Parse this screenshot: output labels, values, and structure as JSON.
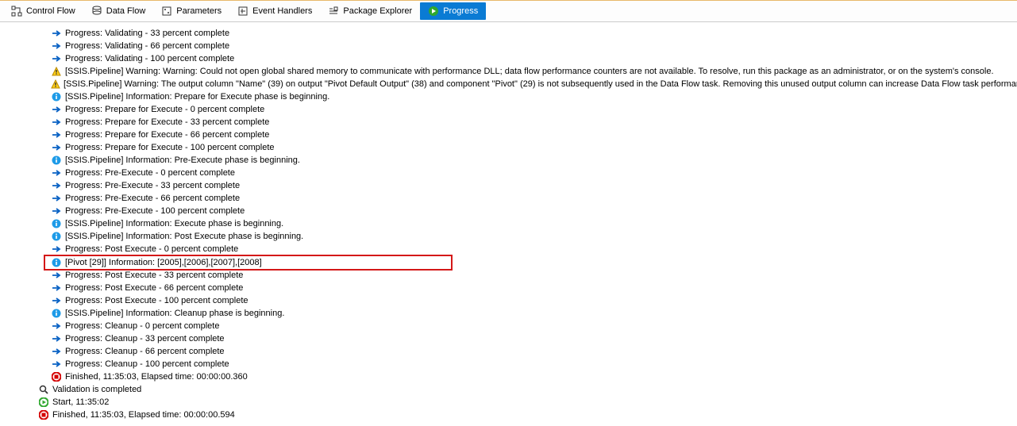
{
  "tabs": {
    "control_flow": "Control Flow",
    "data_flow": "Data Flow",
    "parameters": "Parameters",
    "event_handlers": "Event Handlers",
    "package_explorer": "Package Explorer",
    "progress": "Progress"
  },
  "log": [
    {
      "lvl": 3,
      "icon": "arrow",
      "text": "Progress: Validating - 33 percent complete"
    },
    {
      "lvl": 3,
      "icon": "arrow",
      "text": "Progress: Validating - 66 percent complete"
    },
    {
      "lvl": 3,
      "icon": "arrow",
      "text": "Progress: Validating - 100 percent complete"
    },
    {
      "lvl": 3,
      "icon": "warn",
      "text": "[SSIS.Pipeline] Warning: Warning: Could not open global shared memory to communicate with performance DLL; data flow performance counters are not available.  To resolve, run this package as an administrator, or on the system's console."
    },
    {
      "lvl": 3,
      "icon": "warn",
      "text": "[SSIS.Pipeline] Warning: The output column \"Name\" (39) on output \"Pivot Default Output\" (38) and component \"Pivot\" (29) is not subsequently used in the Data Flow task. Removing this unused output column can increase Data Flow task performance."
    },
    {
      "lvl": 3,
      "icon": "info",
      "text": "[SSIS.Pipeline] Information: Prepare for Execute phase is beginning."
    },
    {
      "lvl": 3,
      "icon": "arrow",
      "text": "Progress: Prepare for Execute - 0 percent complete"
    },
    {
      "lvl": 3,
      "icon": "arrow",
      "text": "Progress: Prepare for Execute - 33 percent complete"
    },
    {
      "lvl": 3,
      "icon": "arrow",
      "text": "Progress: Prepare for Execute - 66 percent complete"
    },
    {
      "lvl": 3,
      "icon": "arrow",
      "text": "Progress: Prepare for Execute - 100 percent complete"
    },
    {
      "lvl": 3,
      "icon": "info",
      "text": "[SSIS.Pipeline] Information: Pre-Execute phase is beginning."
    },
    {
      "lvl": 3,
      "icon": "arrow",
      "text": "Progress: Pre-Execute - 0 percent complete"
    },
    {
      "lvl": 3,
      "icon": "arrow",
      "text": "Progress: Pre-Execute - 33 percent complete"
    },
    {
      "lvl": 3,
      "icon": "arrow",
      "text": "Progress: Pre-Execute - 66 percent complete"
    },
    {
      "lvl": 3,
      "icon": "arrow",
      "text": "Progress: Pre-Execute - 100 percent complete"
    },
    {
      "lvl": 3,
      "icon": "info",
      "text": "[SSIS.Pipeline] Information: Execute phase is beginning."
    },
    {
      "lvl": 3,
      "icon": "info",
      "text": "[SSIS.Pipeline] Information: Post Execute phase is beginning."
    },
    {
      "lvl": 3,
      "icon": "arrow",
      "text": "Progress: Post Execute - 0 percent complete"
    },
    {
      "lvl": 3,
      "icon": "info",
      "text": "[Pivot [29]] Information: [2005],[2006],[2007],[2008]",
      "hl": true
    },
    {
      "lvl": 3,
      "icon": "arrow",
      "text": "Progress: Post Execute - 33 percent complete",
      "overflow": true
    },
    {
      "lvl": 3,
      "icon": "arrow",
      "text": "Progress: Post Execute - 66 percent complete"
    },
    {
      "lvl": 3,
      "icon": "arrow",
      "text": "Progress: Post Execute - 100 percent complete"
    },
    {
      "lvl": 3,
      "icon": "info",
      "text": "[SSIS.Pipeline] Information: Cleanup phase is beginning."
    },
    {
      "lvl": 3,
      "icon": "arrow",
      "text": "Progress: Cleanup - 0 percent complete"
    },
    {
      "lvl": 3,
      "icon": "arrow",
      "text": "Progress: Cleanup - 33 percent complete"
    },
    {
      "lvl": 3,
      "icon": "arrow",
      "text": "Progress: Cleanup - 66 percent complete"
    },
    {
      "lvl": 3,
      "icon": "arrow",
      "text": "Progress: Cleanup - 100 percent complete"
    },
    {
      "lvl": 3,
      "icon": "stop",
      "text": "Finished, 11:35:03, Elapsed time: 00:00:00.360"
    },
    {
      "lvl": 2,
      "icon": "mag",
      "text": "Validation is completed"
    },
    {
      "lvl": 2,
      "icon": "play",
      "text": "Start, 11:35:02"
    },
    {
      "lvl": 2,
      "icon": "stop",
      "text": "Finished, 11:35:03, Elapsed time: 00:00:00.594"
    }
  ]
}
